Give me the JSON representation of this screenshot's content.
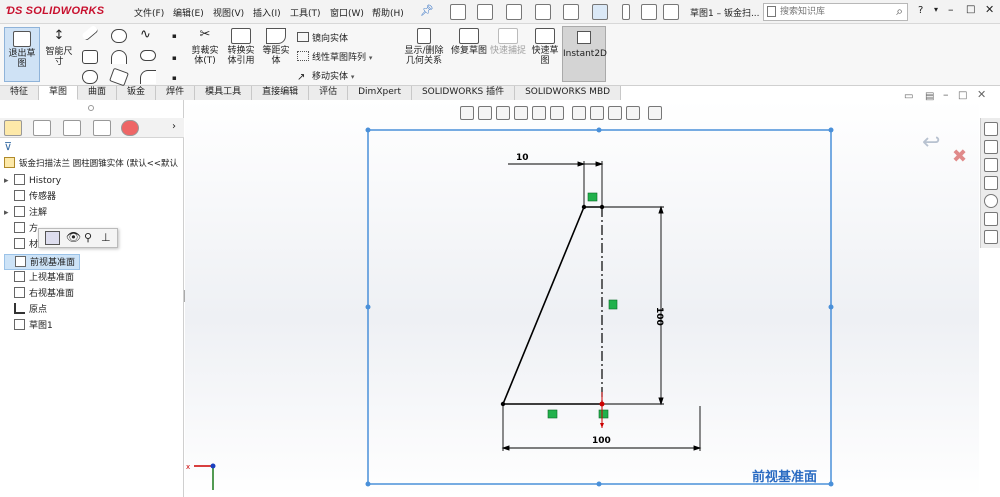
{
  "app": {
    "brand": "SOLIDWORKS",
    "doc_title": "草图1 – 钣金扫..."
  },
  "menu": [
    "文件(F)",
    "编辑(E)",
    "视图(V)",
    "插入(I)",
    "工具(T)",
    "窗口(W)",
    "帮助(H)"
  ],
  "search": {
    "placeholder": "搜索知识库"
  },
  "ribbon": {
    "exit_sketch": "退出草图",
    "smart_dim": "智能尺寸",
    "trim": "剪裁实体(T)",
    "convert": "转换实体引用",
    "offset": "等距实体",
    "mirror": "镜向实体",
    "linear_pattern": "线性草图阵列",
    "move": "移动实体",
    "relations": "显示/删除几何关系",
    "repair": "修复草图",
    "quick_snaps": "快速捕捉",
    "rapid_sketch": "快速草图",
    "instant2d": "Instant2D"
  },
  "tabs": [
    "特征",
    "草图",
    "曲面",
    "钣金",
    "焊件",
    "模具工具",
    "直接编辑",
    "评估",
    "DimXpert",
    "SOLIDWORKS 插件",
    "SOLIDWORKS MBD"
  ],
  "active_tab": "草图",
  "tree": {
    "root": "钣金扫描法兰 圆柱圆锥实体 (默认<<默认",
    "items": [
      {
        "label": "History",
        "expandable": true
      },
      {
        "label": "传感器",
        "expandable": false
      },
      {
        "label": "注解",
        "expandable": true
      },
      {
        "label": "方",
        "expandable": false
      },
      {
        "label": "材",
        "expandable": false
      },
      {
        "label": "前视基准面",
        "expandable": false,
        "selected": true
      },
      {
        "label": "上视基准面",
        "expandable": false
      },
      {
        "label": "右视基准面",
        "expandable": false
      },
      {
        "label": "原点",
        "expandable": false
      },
      {
        "label": "草图1",
        "expandable": false
      }
    ]
  },
  "dimensions": {
    "top_width": "10",
    "height": "100",
    "base_width": "100"
  },
  "plane_label": "前视基准面",
  "colors": {
    "sketch_line": "#000000",
    "plane_border": "#4a90d9",
    "relation_box": "#22b14c",
    "accent_blue": "#2a6bc2",
    "brand_red": "#c8102e"
  }
}
